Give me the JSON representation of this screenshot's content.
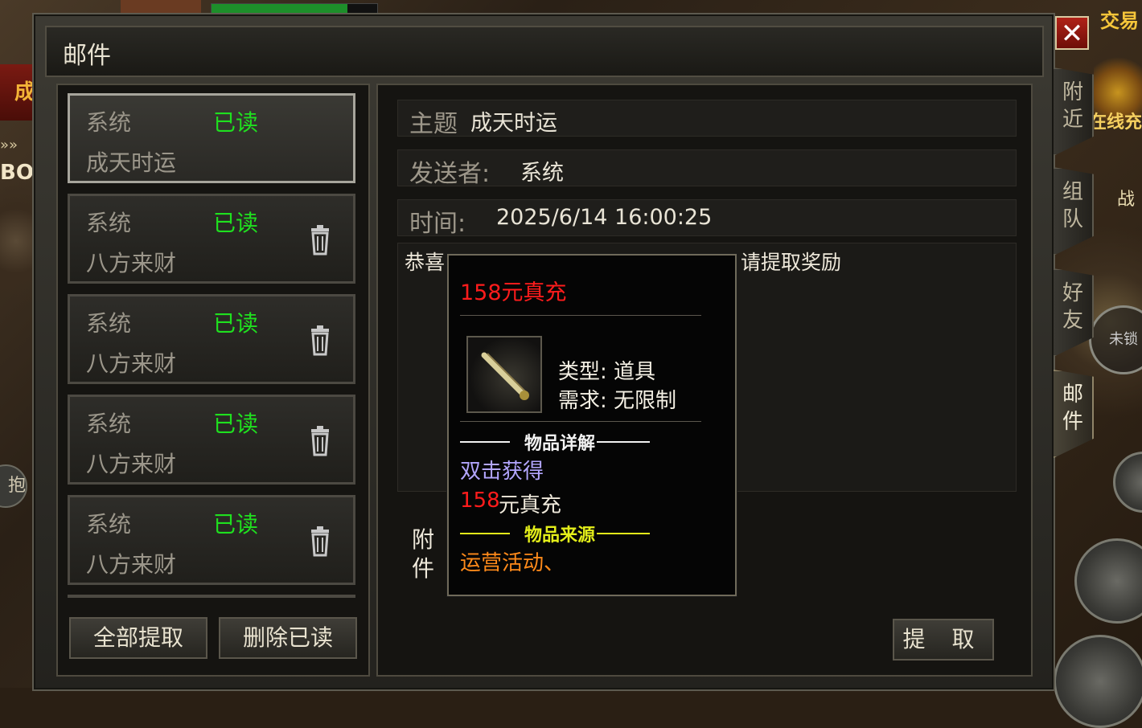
{
  "background": {
    "left_banner": "成就",
    "left_arrows": "»»",
    "left_bos": "BOS",
    "left_round": "抱",
    "trade": "交易",
    "gold_text": "在线充",
    "war": "战",
    "compass_text": "未锁",
    "hp_bar_fraction": 0.82
  },
  "window": {
    "title": "邮件",
    "close_glyph": "✕"
  },
  "side_tabs": [
    {
      "label": "附近"
    },
    {
      "label": "组队"
    },
    {
      "label": "好友"
    },
    {
      "label": "邮件"
    }
  ],
  "mail_list": [
    {
      "sender": "系统",
      "status": "已读",
      "subject": "成天时运"
    },
    {
      "sender": "系统",
      "status": "已读",
      "subject": "八方来财"
    },
    {
      "sender": "系统",
      "status": "已读",
      "subject": "八方来财"
    },
    {
      "sender": "系统",
      "status": "已读",
      "subject": "八方来财"
    },
    {
      "sender": "系统",
      "status": "已读",
      "subject": "八方来财"
    }
  ],
  "buttons": {
    "collect_all": "全部提取",
    "delete_read": "删除已读",
    "collect": "提 取"
  },
  "detail": {
    "subject_label": "主题",
    "subject_value": "成天时运",
    "sender_label": "发送者:",
    "sender_value": "系统",
    "time_label": "时间:",
    "time_value": "2025/6/14 16:00:25",
    "content_visible_start": "恭喜",
    "content_visible_end": "请提取奖励",
    "attachment_label": "附件"
  },
  "tooltip": {
    "item_name": "158元真充",
    "type_label": "类型: 道具",
    "requirement_label": "需求: 无限制",
    "details_header": "物品详解",
    "desc_action": "双击获得",
    "desc_amount": "158",
    "desc_amount_suffix": "元真充",
    "source_header": "物品来源",
    "source_value": "运营活动、",
    "colors": {
      "item_name": "#ff1c1c",
      "details_divider": "#f2f2f2",
      "source_divider": "#e3ee1a",
      "action": "#b3a6ff",
      "amount": "#ff1c1c",
      "source": "#ff8a1a"
    }
  },
  "colors": {
    "status_read": "#1fe01f",
    "close_button": "#b02218"
  }
}
